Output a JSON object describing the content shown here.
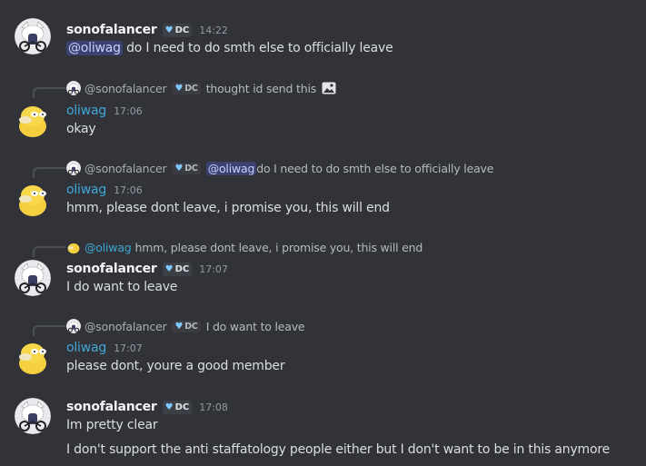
{
  "messages": [
    {
      "user": "sonofalancer",
      "badge": "DC",
      "time": "14:22",
      "mention": "@oliwag",
      "text": " do I need to do smth else to officially leave"
    },
    {
      "reply": {
        "user": "@sonofalancer",
        "badge": "DC",
        "text": "thought id send this",
        "icon": "image-icon"
      },
      "user": "oliwag",
      "time": "17:06",
      "text": "okay"
    },
    {
      "reply": {
        "user": "@sonofalancer",
        "badge": "DC",
        "mention": "@oliwag",
        "text": " do I need to do smth else to officially leave"
      },
      "user": "oliwag",
      "time": "17:06",
      "text": "hmm, please dont leave, i promise you, this will end"
    },
    {
      "reply": {
        "user": "@oliwag",
        "text": "hmm, please dont leave, i promise you, this will end"
      },
      "user": "sonofalancer",
      "badge": "DC",
      "time": "17:07",
      "text": "I do want to leave"
    },
    {
      "reply": {
        "user": "@sonofalancer",
        "badge": "DC",
        "text": "I do want to leave"
      },
      "user": "oliwag",
      "time": "17:07",
      "text": "please dont, youre a good member"
    },
    {
      "user": "sonofalancer",
      "badge": "DC",
      "time": "17:08",
      "text": "Im pretty clear",
      "text2": "I don't support the anti staffatology people either but I don't want to be in this anymore"
    }
  ],
  "colors": {
    "background": "#313338",
    "oliwag_name": "#3fa7d6",
    "mention_bg": "#3c4270",
    "badge_heart": "#7ec9ff"
  }
}
